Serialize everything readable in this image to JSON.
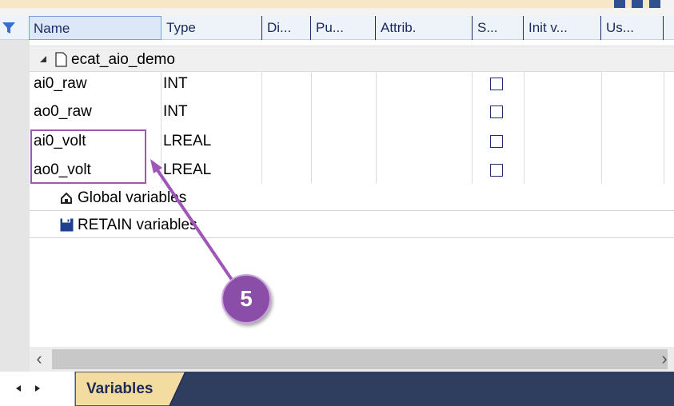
{
  "columns": [
    "Name",
    "Type",
    "Di...",
    "Pu...",
    "Attrib.",
    "S...",
    "Init v...",
    "Us..."
  ],
  "group": {
    "name": "ecat_aio_demo"
  },
  "rows": [
    {
      "name": "ai0_raw",
      "type": "INT"
    },
    {
      "name": "ao0_raw",
      "type": "INT"
    },
    {
      "name": "ai0_volt",
      "type": "LREAL"
    },
    {
      "name": "ao0_volt",
      "type": "LREAL"
    }
  ],
  "subfolders": [
    {
      "label": "Global variables",
      "icon": "home-icon"
    },
    {
      "label": "RETAIN variables",
      "icon": "save-icon"
    }
  ],
  "tabs": [
    {
      "label": "Variables"
    }
  ],
  "annotation": {
    "badge": "5",
    "color": "#8a4ea8"
  },
  "colors": {
    "header_text": "#1a2a5e",
    "tab_bar": "#2f3d5f",
    "annotation": "#a055b8"
  }
}
